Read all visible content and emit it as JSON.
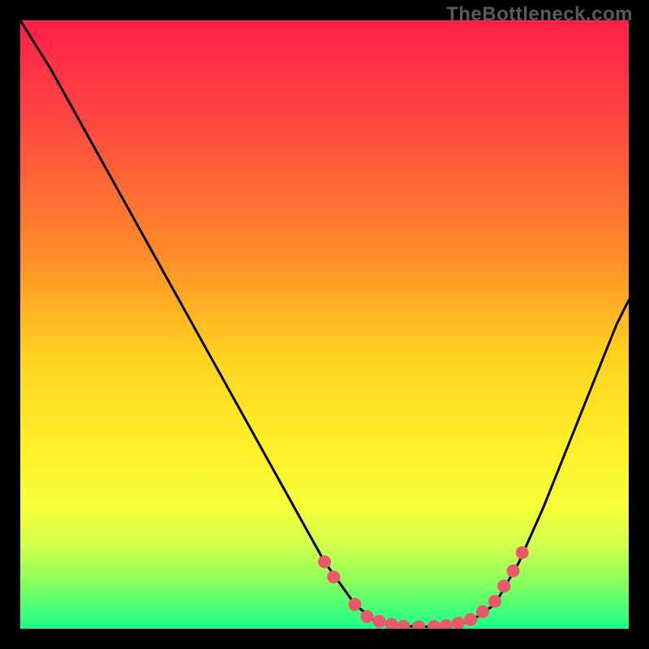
{
  "watermark": "TheBottleneck.com",
  "chart_data": {
    "type": "line",
    "title": "",
    "xlabel": "",
    "ylabel": "",
    "xlim": [
      0,
      100
    ],
    "ylim": [
      0,
      100
    ],
    "gradient_stops": [
      {
        "offset": 0,
        "color": "#ff1f4b"
      },
      {
        "offset": 18,
        "color": "#ff4b3f"
      },
      {
        "offset": 38,
        "color": "#ff8a2a"
      },
      {
        "offset": 55,
        "color": "#ffd21f"
      },
      {
        "offset": 70,
        "color": "#fff02a"
      },
      {
        "offset": 80,
        "color": "#f6ff3a"
      },
      {
        "offset": 86,
        "color": "#d6ff4a"
      },
      {
        "offset": 92,
        "color": "#8dff5a"
      },
      {
        "offset": 100,
        "color": "#1aff8a"
      }
    ],
    "series": [
      {
        "name": "bottleneck-curve",
        "x": [
          0.0,
          5.0,
          10.0,
          15.0,
          20.0,
          25.0,
          30.0,
          35.0,
          40.0,
          45.0,
          50.0,
          55.0,
          58.0,
          62.0,
          66.0,
          70.0,
          74.0,
          78.0,
          82.0,
          86.0,
          90.0,
          94.0,
          98.0,
          100.0
        ],
        "y": [
          100.0,
          92.0,
          83.0,
          74.0,
          65.0,
          56.0,
          47.0,
          38.0,
          29.0,
          20.0,
          11.0,
          4.0,
          1.5,
          0.5,
          0.3,
          0.4,
          1.2,
          4.0,
          11.0,
          20.0,
          30.0,
          40.0,
          50.0,
          54.0
        ]
      }
    ],
    "markers": {
      "name": "highlight-points",
      "color": "#e85a6a",
      "radius": 8,
      "points": [
        {
          "x": 50.0,
          "y": 11.0
        },
        {
          "x": 51.5,
          "y": 8.5
        },
        {
          "x": 55.0,
          "y": 4.0
        },
        {
          "x": 57.0,
          "y": 2.0
        },
        {
          "x": 59.0,
          "y": 1.2
        },
        {
          "x": 61.0,
          "y": 0.7
        },
        {
          "x": 63.0,
          "y": 0.4
        },
        {
          "x": 65.5,
          "y": 0.3
        },
        {
          "x": 68.0,
          "y": 0.35
        },
        {
          "x": 70.0,
          "y": 0.5
        },
        {
          "x": 72.0,
          "y": 0.9
        },
        {
          "x": 74.0,
          "y": 1.5
        },
        {
          "x": 76.0,
          "y": 2.8
        },
        {
          "x": 78.0,
          "y": 4.5
        },
        {
          "x": 79.5,
          "y": 7.0
        },
        {
          "x": 81.0,
          "y": 9.5
        },
        {
          "x": 82.5,
          "y": 12.5
        }
      ]
    }
  }
}
